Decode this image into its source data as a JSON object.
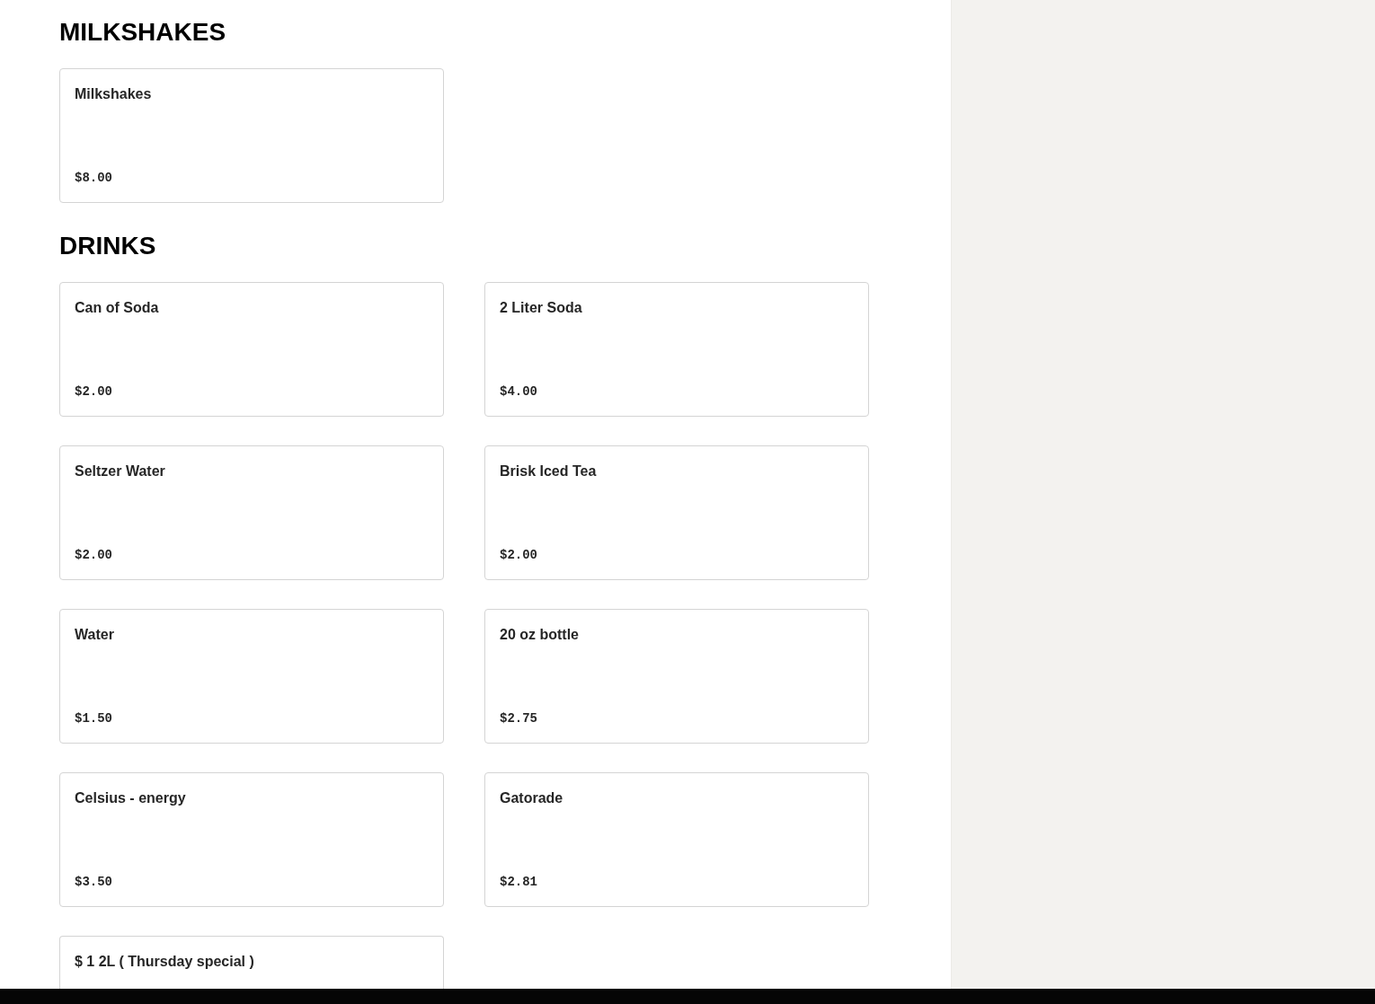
{
  "sections": [
    {
      "title": "MILKSHAKES",
      "items": [
        {
          "name": "Milkshakes",
          "price": "$8.00"
        }
      ]
    },
    {
      "title": "DRINKS",
      "items": [
        {
          "name": "Can of Soda",
          "price": "$2.00"
        },
        {
          "name": "2 Liter Soda",
          "price": "$4.00"
        },
        {
          "name": "Seltzer Water",
          "price": "$2.00"
        },
        {
          "name": "Brisk Iced Tea",
          "price": "$2.00"
        },
        {
          "name": "Water",
          "price": "$1.50"
        },
        {
          "name": "20 oz bottle",
          "price": "$2.75"
        },
        {
          "name": "Celsius - energy",
          "price": "$3.50"
        },
        {
          "name": "Gatorade",
          "price": "$2.81"
        },
        {
          "name": "$ 1 2L ( Thursday special )"
        }
      ]
    }
  ]
}
